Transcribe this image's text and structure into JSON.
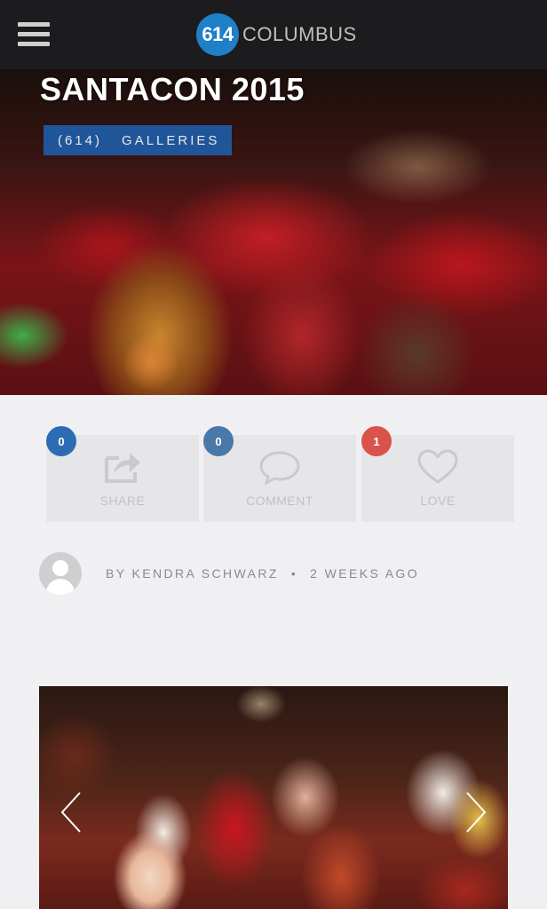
{
  "header": {
    "logo_number": "614",
    "logo_text": "COLUMBUS",
    "menu_icon": "hamburger-menu-icon"
  },
  "hero": {
    "title": "SANTACON 2015",
    "tags": [
      "(614)",
      "GALLERIES"
    ]
  },
  "stats": [
    {
      "label": "SHARE",
      "count": "0",
      "icon": "share-icon",
      "badge_color": "#2c6cb4"
    },
    {
      "label": "COMMENT",
      "count": "0",
      "icon": "comment-icon",
      "badge_color": "#4a78a8"
    },
    {
      "label": "LOVE",
      "count": "1",
      "icon": "heart-icon",
      "badge_color": "#d9534a"
    }
  ],
  "author": {
    "byline": "BY KENDRA SCHWARZ",
    "separator": "•",
    "time": "2 WEEKS AGO"
  },
  "gallery": {
    "prev_icon": "chevron-left-icon",
    "next_icon": "chevron-right-icon"
  }
}
